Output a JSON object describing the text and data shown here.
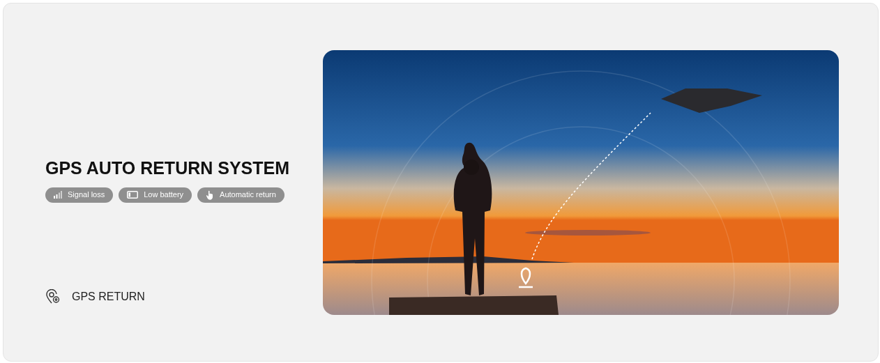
{
  "heading": "GPS AUTO RETURN SYSTEM",
  "badges": [
    {
      "kind": "signal",
      "label": "Signal loss"
    },
    {
      "kind": "battery",
      "label": "Low battery"
    },
    {
      "kind": "hand",
      "label": "Automatic return"
    }
  ],
  "feature": {
    "label": "GPS RETURN"
  }
}
